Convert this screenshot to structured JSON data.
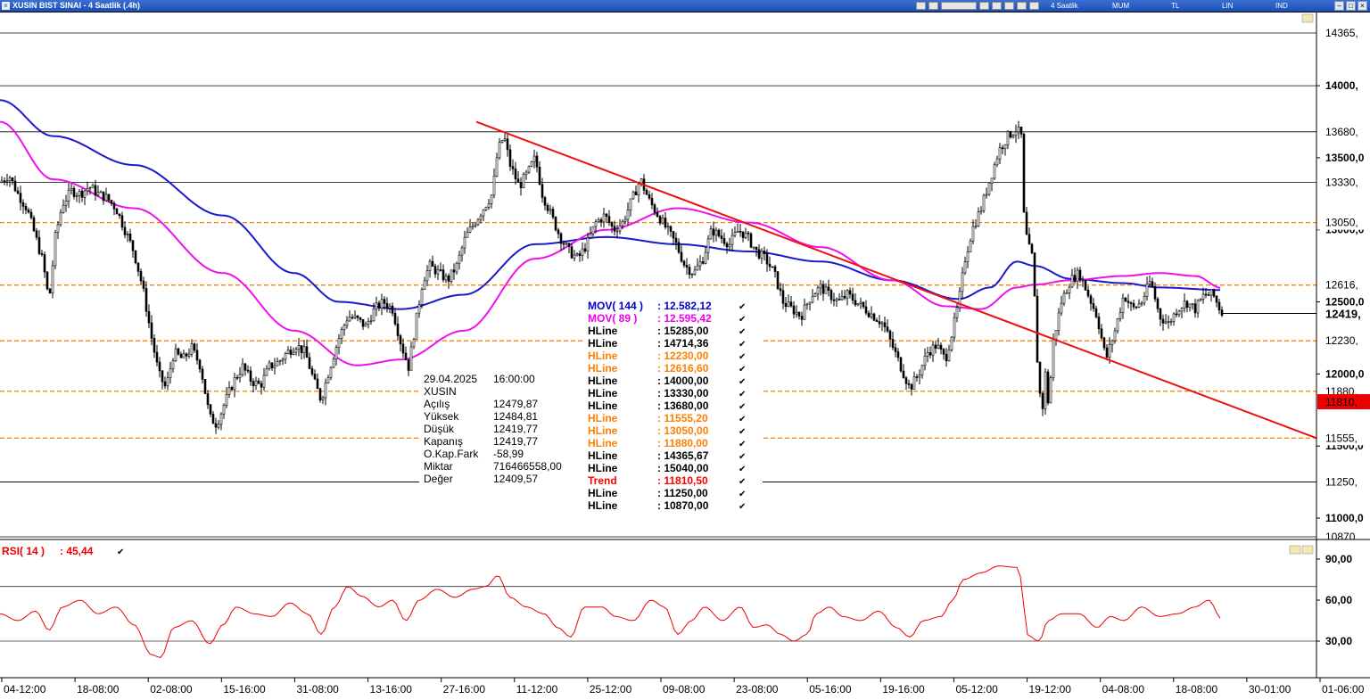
{
  "window": {
    "title": "XUSIN BIST SINAI - 4 Saatlik (.4h)",
    "toolbar": [
      "4 Saatlik",
      "MUM",
      "TL",
      "LIN",
      "IND"
    ]
  },
  "info_box": {
    "date": "29.04.2025",
    "time": "16:00:00",
    "symbol": "XUSIN",
    "rows": [
      {
        "label": "Açılış",
        "value": "12479,87"
      },
      {
        "label": "Yüksek",
        "value": "12484,81"
      },
      {
        "label": "Düşük",
        "value": "12419,77"
      },
      {
        "label": "Kapanış",
        "value": "12419,77"
      },
      {
        "label": "O.Kap.Fark",
        "value": "-58,99"
      },
      {
        "label": "Miktar",
        "value": "716466558,00"
      },
      {
        "label": "Değer",
        "value": "12409,57"
      }
    ]
  },
  "legend": [
    {
      "label": "MOV( 144 )",
      "value": ": 12.582,12",
      "color": "#0000cc",
      "line": "#1a1acc"
    },
    {
      "label": "MOV( 89 )",
      "value": ": 12.595,42",
      "color": "#ee00ee",
      "line": "#ee11ee"
    },
    {
      "label": "HLine",
      "value": ": 15285,00",
      "color": "#000000"
    },
    {
      "label": "HLine",
      "value": ": 14714,36",
      "color": "#000000"
    },
    {
      "label": "HLine",
      "value": ": 12230,00",
      "color": "#ff8000"
    },
    {
      "label": "HLine",
      "value": ": 12616,60",
      "color": "#ff8000"
    },
    {
      "label": "HLine",
      "value": ": 14000,00",
      "color": "#000000"
    },
    {
      "label": "HLine",
      "value": ": 13330,00",
      "color": "#000000"
    },
    {
      "label": "HLine",
      "value": ": 13680,00",
      "color": "#000000"
    },
    {
      "label": "HLine",
      "value": ": 11555,20",
      "color": "#ff8000"
    },
    {
      "label": "HLine",
      "value": ": 13050,00",
      "color": "#ff8000"
    },
    {
      "label": "HLine",
      "value": ": 11880,00",
      "color": "#ff8000"
    },
    {
      "label": "HLine",
      "value": ": 14365,67",
      "color": "#000000"
    },
    {
      "label": "HLine",
      "value": ": 15040,00",
      "color": "#000000"
    },
    {
      "label": "Trend",
      "value": ": 11810,50",
      "color": "#ff0000"
    },
    {
      "label": "HLine",
      "value": ": 11250,00",
      "color": "#000000"
    },
    {
      "label": "HLine",
      "value": ": 10870,00",
      "color": "#000000"
    }
  ],
  "price_axis": {
    "ticks": [
      "14000,",
      "13500,0",
      "13000,0",
      "12500,0",
      "12000,0",
      "11500,0",
      "11000,0"
    ],
    "line_tags": [
      {
        "text": "14365,",
        "value": 14365.67
      },
      {
        "text": "13680,",
        "value": 13680
      },
      {
        "text": "13330,",
        "value": 13330
      },
      {
        "text": "13050,",
        "value": 13050
      },
      {
        "text": "12616,",
        "value": 12616.6
      },
      {
        "text": "12230,",
        "value": 12230
      },
      {
        "text": "11880,",
        "value": 11880
      },
      {
        "text": "11555,",
        "value": 11555.2
      },
      {
        "text": "11250,",
        "value": 11250
      },
      {
        "text": "10870,",
        "value": 10870
      }
    ],
    "last_price": {
      "text": "12419,",
      "value": 12419.77
    },
    "trend_tag": {
      "text": "11810,",
      "value": 11810.5
    }
  },
  "rsi": {
    "label": "RSI( 14 )",
    "value": ": 45,44",
    "ticks": [
      "90,00",
      "60,00",
      "30,00"
    ],
    "levels": [
      70,
      30
    ]
  },
  "x_axis": [
    "04-12:00",
    "18-08:00",
    "02-08:00",
    "15-16:00",
    "31-08:00",
    "13-16:00",
    "27-16:00",
    "11-12:00",
    "25-12:00",
    "09-08:00",
    "23-08:00",
    "05-16:00",
    "19-16:00",
    "05-12:00",
    "19-12:00",
    "04-08:00",
    "18-08:00",
    "30-01:00",
    "01-06:00"
  ],
  "chart_data": [
    {
      "type": "candlestick",
      "title": "XUSIN BIST SINAI - 4 Saatlik (.4h)",
      "ylim": [
        10870,
        14420
      ],
      "x_ticks": [
        "04-12:00",
        "18-08:00",
        "02-08:00",
        "15-16:00",
        "31-08:00",
        "13-16:00",
        "27-16:00",
        "11-12:00",
        "25-12:00",
        "09-08:00",
        "23-08:00",
        "05-16:00",
        "19-16:00",
        "05-12:00",
        "19-12:00",
        "04-08:00",
        "18-08:00",
        "30-01:00",
        "01-06:00"
      ],
      "close_path": [
        [
          0,
          13330
        ],
        [
          10,
          13380
        ],
        [
          20,
          13250
        ],
        [
          30,
          13150
        ],
        [
          40,
          12950
        ],
        [
          48,
          12780
        ],
        [
          55,
          12500
        ],
        [
          62,
          12950
        ],
        [
          70,
          13180
        ],
        [
          80,
          13270
        ],
        [
          90,
          13250
        ],
        [
          100,
          13300
        ],
        [
          110,
          13250
        ],
        [
          120,
          13220
        ],
        [
          130,
          13150
        ],
        [
          140,
          13000
        ],
        [
          150,
          12850
        ],
        [
          160,
          12600
        ],
        [
          170,
          12250
        ],
        [
          178,
          12000
        ],
        [
          186,
          11900
        ],
        [
          195,
          12150
        ],
        [
          205,
          12100
        ],
        [
          215,
          12180
        ],
        [
          225,
          12050
        ],
        [
          235,
          11700
        ],
        [
          243,
          11650
        ],
        [
          252,
          11800
        ],
        [
          262,
          11950
        ],
        [
          272,
          12050
        ],
        [
          282,
          11950
        ],
        [
          292,
          11920
        ],
        [
          302,
          12050
        ],
        [
          312,
          12080
        ],
        [
          322,
          12150
        ],
        [
          332,
          12200
        ],
        [
          342,
          12150
        ],
        [
          352,
          11950
        ],
        [
          360,
          11820
        ],
        [
          370,
          12050
        ],
        [
          380,
          12250
        ],
        [
          390,
          12400
        ],
        [
          400,
          12380
        ],
        [
          410,
          12330
        ],
        [
          420,
          12450
        ],
        [
          430,
          12500
        ],
        [
          440,
          12450
        ],
        [
          450,
          12200
        ],
        [
          458,
          12050
        ],
        [
          466,
          12350
        ],
        [
          474,
          12650
        ],
        [
          482,
          12750
        ],
        [
          492,
          12700
        ],
        [
          502,
          12650
        ],
        [
          512,
          12750
        ],
        [
          522,
          12950
        ],
        [
          532,
          13050
        ],
        [
          542,
          13150
        ],
        [
          552,
          13250
        ],
        [
          558,
          13550
        ],
        [
          565,
          13650
        ],
        [
          572,
          13450
        ],
        [
          582,
          13300
        ],
        [
          592,
          13400
        ],
        [
          600,
          13500
        ],
        [
          608,
          13250
        ],
        [
          618,
          13100
        ],
        [
          628,
          12950
        ],
        [
          638,
          12850
        ],
        [
          648,
          12800
        ],
        [
          658,
          12900
        ],
        [
          668,
          13050
        ],
        [
          678,
          13100
        ],
        [
          688,
          13000
        ],
        [
          698,
          13050
        ],
        [
          708,
          13200
        ],
        [
          718,
          13350
        ],
        [
          728,
          13200
        ],
        [
          738,
          13100
        ],
        [
          748,
          13000
        ],
        [
          758,
          12900
        ],
        [
          768,
          12750
        ],
        [
          778,
          12700
        ],
        [
          788,
          12800
        ],
        [
          798,
          13000
        ],
        [
          808,
          12950
        ],
        [
          818,
          12900
        ],
        [
          828,
          13000
        ],
        [
          838,
          12950
        ],
        [
          848,
          12850
        ],
        [
          858,
          12800
        ],
        [
          868,
          12700
        ],
        [
          878,
          12500
        ],
        [
          888,
          12450
        ],
        [
          898,
          12400
        ],
        [
          910,
          12550
        ],
        [
          920,
          12600
        ],
        [
          930,
          12550
        ],
        [
          940,
          12500
        ],
        [
          950,
          12550
        ],
        [
          960,
          12500
        ],
        [
          970,
          12450
        ],
        [
          980,
          12400
        ],
        [
          990,
          12350
        ],
        [
          1000,
          12200
        ],
        [
          1010,
          12050
        ],
        [
          1020,
          11900
        ],
        [
          1030,
          12000
        ],
        [
          1040,
          12150
        ],
        [
          1050,
          12200
        ],
        [
          1060,
          12100
        ],
        [
          1068,
          12300
        ],
        [
          1075,
          12500
        ],
        [
          1082,
          12800
        ],
        [
          1090,
          13000
        ],
        [
          1100,
          13150
        ],
        [
          1110,
          13350
        ],
        [
          1120,
          13550
        ],
        [
          1130,
          13650
        ],
        [
          1140,
          13700
        ],
        [
          1145,
          13650
        ],
        [
          1148,
          13100
        ],
        [
          1152,
          12900
        ],
        [
          1158,
          12800
        ],
        [
          1163,
          12100
        ],
        [
          1168,
          11700
        ],
        [
          1172,
          12000
        ],
        [
          1176,
          11750
        ],
        [
          1180,
          12200
        ],
        [
          1190,
          12500
        ],
        [
          1200,
          12650
        ],
        [
          1210,
          12700
        ],
        [
          1220,
          12550
        ],
        [
          1230,
          12400
        ],
        [
          1240,
          12100
        ],
        [
          1250,
          12300
        ],
        [
          1260,
          12550
        ],
        [
          1270,
          12450
        ],
        [
          1280,
          12500
        ],
        [
          1290,
          12650
        ],
        [
          1300,
          12400
        ],
        [
          1310,
          12350
        ],
        [
          1320,
          12450
        ],
        [
          1330,
          12500
        ],
        [
          1340,
          12450
        ],
        [
          1350,
          12550
        ],
        [
          1360,
          12550
        ],
        [
          1370,
          12420
        ]
      ],
      "ma_144_path": [
        [
          0,
          13900
        ],
        [
          60,
          13650
        ],
        [
          150,
          13450
        ],
        [
          250,
          13100
        ],
        [
          330,
          12700
        ],
        [
          380,
          12500
        ],
        [
          450,
          12450
        ],
        [
          520,
          12550
        ],
        [
          600,
          12900
        ],
        [
          680,
          12950
        ],
        [
          760,
          12900
        ],
        [
          840,
          12850
        ],
        [
          920,
          12780
        ],
        [
          1000,
          12650
        ],
        [
          1075,
          12520
        ],
        [
          1110,
          12600
        ],
        [
          1140,
          12780
        ],
        [
          1160,
          12750
        ],
        [
          1200,
          12660
        ],
        [
          1260,
          12630
        ],
        [
          1300,
          12600
        ],
        [
          1370,
          12582.12
        ]
      ],
      "ma_89_path": [
        [
          0,
          13750
        ],
        [
          60,
          13350
        ],
        [
          150,
          13150
        ],
        [
          250,
          12700
        ],
        [
          330,
          12300
        ],
        [
          400,
          12060
        ],
        [
          450,
          12100
        ],
        [
          520,
          12300
        ],
        [
          600,
          12800
        ],
        [
          680,
          13000
        ],
        [
          760,
          13150
        ],
        [
          840,
          13050
        ],
        [
          920,
          12880
        ],
        [
          1000,
          12650
        ],
        [
          1060,
          12470
        ],
        [
          1100,
          12450
        ],
        [
          1140,
          12600
        ],
        [
          1160,
          12620
        ],
        [
          1200,
          12650
        ],
        [
          1260,
          12680
        ],
        [
          1300,
          12700
        ],
        [
          1340,
          12680
        ],
        [
          1370,
          12595.42
        ]
      ],
      "trend_line": [
        [
          534,
          13750
        ],
        [
          1476,
          11555
        ]
      ],
      "hlines_drawn": [
        14365.67,
        14000,
        13680,
        13330,
        13050,
        12616.6,
        12230,
        11880,
        11555.2,
        11250,
        10870
      ]
    },
    {
      "type": "line",
      "title": "RSI( 14 )",
      "ylim": [
        10,
        100
      ],
      "levels": [
        70,
        30
      ],
      "path": [
        [
          0,
          50
        ],
        [
          20,
          45
        ],
        [
          40,
          52
        ],
        [
          55,
          38
        ],
        [
          70,
          55
        ],
        [
          90,
          60
        ],
        [
          110,
          50
        ],
        [
          130,
          55
        ],
        [
          150,
          42
        ],
        [
          170,
          20
        ],
        [
          180,
          18
        ],
        [
          195,
          40
        ],
        [
          215,
          45
        ],
        [
          235,
          28
        ],
        [
          250,
          42
        ],
        [
          265,
          55
        ],
        [
          285,
          50
        ],
        [
          305,
          48
        ],
        [
          325,
          58
        ],
        [
          345,
          50
        ],
        [
          360,
          35
        ],
        [
          375,
          55
        ],
        [
          390,
          70
        ],
        [
          405,
          63
        ],
        [
          425,
          55
        ],
        [
          440,
          60
        ],
        [
          455,
          45
        ],
        [
          470,
          60
        ],
        [
          490,
          68
        ],
        [
          510,
          62
        ],
        [
          530,
          68
        ],
        [
          545,
          70
        ],
        [
          558,
          78
        ],
        [
          572,
          62
        ],
        [
          590,
          55
        ],
        [
          610,
          50
        ],
        [
          625,
          40
        ],
        [
          640,
          33
        ],
        [
          655,
          55
        ],
        [
          675,
          55
        ],
        [
          690,
          48
        ],
        [
          710,
          45
        ],
        [
          730,
          60
        ],
        [
          745,
          55
        ],
        [
          760,
          35
        ],
        [
          775,
          45
        ],
        [
          790,
          55
        ],
        [
          810,
          45
        ],
        [
          830,
          55
        ],
        [
          845,
          40
        ],
        [
          860,
          42
        ],
        [
          875,
          35
        ],
        [
          890,
          30
        ],
        [
          905,
          35
        ],
        [
          915,
          50
        ],
        [
          930,
          55
        ],
        [
          945,
          48
        ],
        [
          965,
          45
        ],
        [
          985,
          52
        ],
        [
          1005,
          40
        ],
        [
          1020,
          33
        ],
        [
          1035,
          45
        ],
        [
          1055,
          48
        ],
        [
          1068,
          60
        ],
        [
          1080,
          75
        ],
        [
          1100,
          80
        ],
        [
          1120,
          85
        ],
        [
          1140,
          84
        ],
        [
          1146,
          75
        ],
        [
          1150,
          35
        ],
        [
          1165,
          30
        ],
        [
          1175,
          45
        ],
        [
          1190,
          50
        ],
        [
          1210,
          50
        ],
        [
          1230,
          40
        ],
        [
          1245,
          48
        ],
        [
          1260,
          45
        ],
        [
          1280,
          55
        ],
        [
          1300,
          48
        ],
        [
          1320,
          50
        ],
        [
          1340,
          55
        ],
        [
          1355,
          60
        ],
        [
          1370,
          46
        ]
      ]
    }
  ]
}
